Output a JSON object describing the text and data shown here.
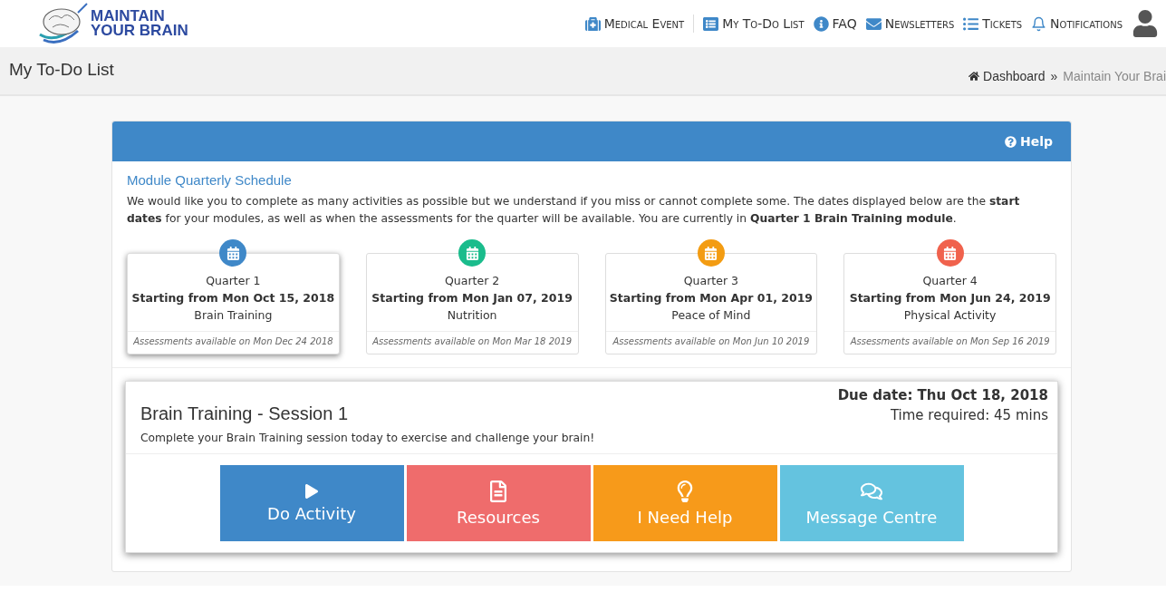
{
  "logo": {
    "line1": "MAINTAIN",
    "line2": "YOUR BRAIN"
  },
  "nav": [
    {
      "label": "Medical Event",
      "kind": "medical"
    },
    {
      "label": "My To-Do List",
      "kind": "list"
    },
    {
      "label": "FAQ",
      "kind": "info"
    },
    {
      "label": "Newsletters",
      "kind": "mail"
    },
    {
      "label": "Tickets",
      "kind": "tickets"
    },
    {
      "label": "Notifications",
      "kind": "bell"
    }
  ],
  "page_title": "My To-Do List",
  "breadcrumb": [
    "Dashboard",
    "»",
    "Maintain Your Brai"
  ],
  "panel": {
    "help": "Help",
    "heading": "Module Quarterly Schedule",
    "intro": "We would like you to complete as many activities as possible but we understand if you miss or cannot complete some. The dates displayed below are the **start dates** for your modules, as well as when the assessments for the quarter will be available. You are currently in **Quarter 1 Brain Training module**.",
    "quarters": [
      {
        "title": "Quarter 1",
        "start": "Starting from Mon Oct 15, 2018",
        "module": "Brain Training",
        "assessments": "Assessments available on Mon Dec 24 2018",
        "color": "#3f88c8",
        "selected": true
      },
      {
        "title": "Quarter 2",
        "start": "Starting from Mon Jan 07, 2019",
        "module": "Nutrition",
        "assessments": "Assessments available on Mon Mar 18 2019",
        "color": "#1abc8c",
        "selected": false
      },
      {
        "title": "Quarter 3",
        "start": "Starting from Mon Apr 01, 2019",
        "module": "Peace of Mind",
        "assessments": "Assessments available on Mon Jun 10 2019",
        "color": "#f39c12",
        "selected": false
      },
      {
        "title": "Quarter 4",
        "start": "Starting from Mon Jun 24, 2019",
        "module": "Physical Activity",
        "assessments": "Assessments available on Mon Sep 16 2019",
        "color": "#f0624d",
        "selected": false
      }
    ],
    "session": {
      "title": "Brain Training - Session 1",
      "due": "Due date: Thu Oct 18, 2018",
      "time": "Time required: 45 mins",
      "description": "Complete your Brain Training session today to exercise and challenge your brain!",
      "actions": [
        {
          "label": "Do Activity",
          "kind": "play",
          "color": "#3f88c8"
        },
        {
          "label": "Resources",
          "kind": "document",
          "color": "#ef6c6c"
        },
        {
          "label": "I Need Help",
          "kind": "lightbulb",
          "color": "#f79a1a"
        },
        {
          "label": "Message Centre",
          "kind": "chat",
          "color": "#64c3df"
        }
      ]
    }
  }
}
